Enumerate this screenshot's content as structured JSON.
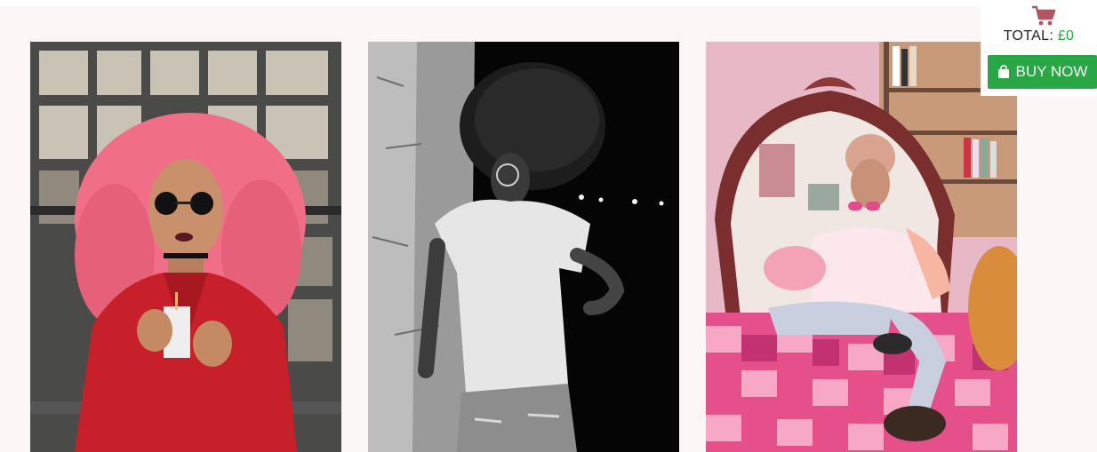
{
  "cart": {
    "icon": "shopping-cart-icon",
    "total_label": "TOTAL:",
    "total_value": "£0",
    "buy_icon": "shopping-bag-icon",
    "buy_label": "BUY NOW"
  },
  "gallery": {
    "items": [
      {
        "subject": "woman with pink curly hair in red jacket holding a drink carton"
      },
      {
        "subject": "black and white photo of woman with afro leaning on a wall"
      },
      {
        "subject": "woman in pink sunglasses sitting on a patchwork quilt before an ornate mirror"
      }
    ]
  },
  "colors": {
    "panel_bg": "#fdf6f6",
    "accent_green": "#28a745",
    "cart_icon": "#b5535f"
  }
}
